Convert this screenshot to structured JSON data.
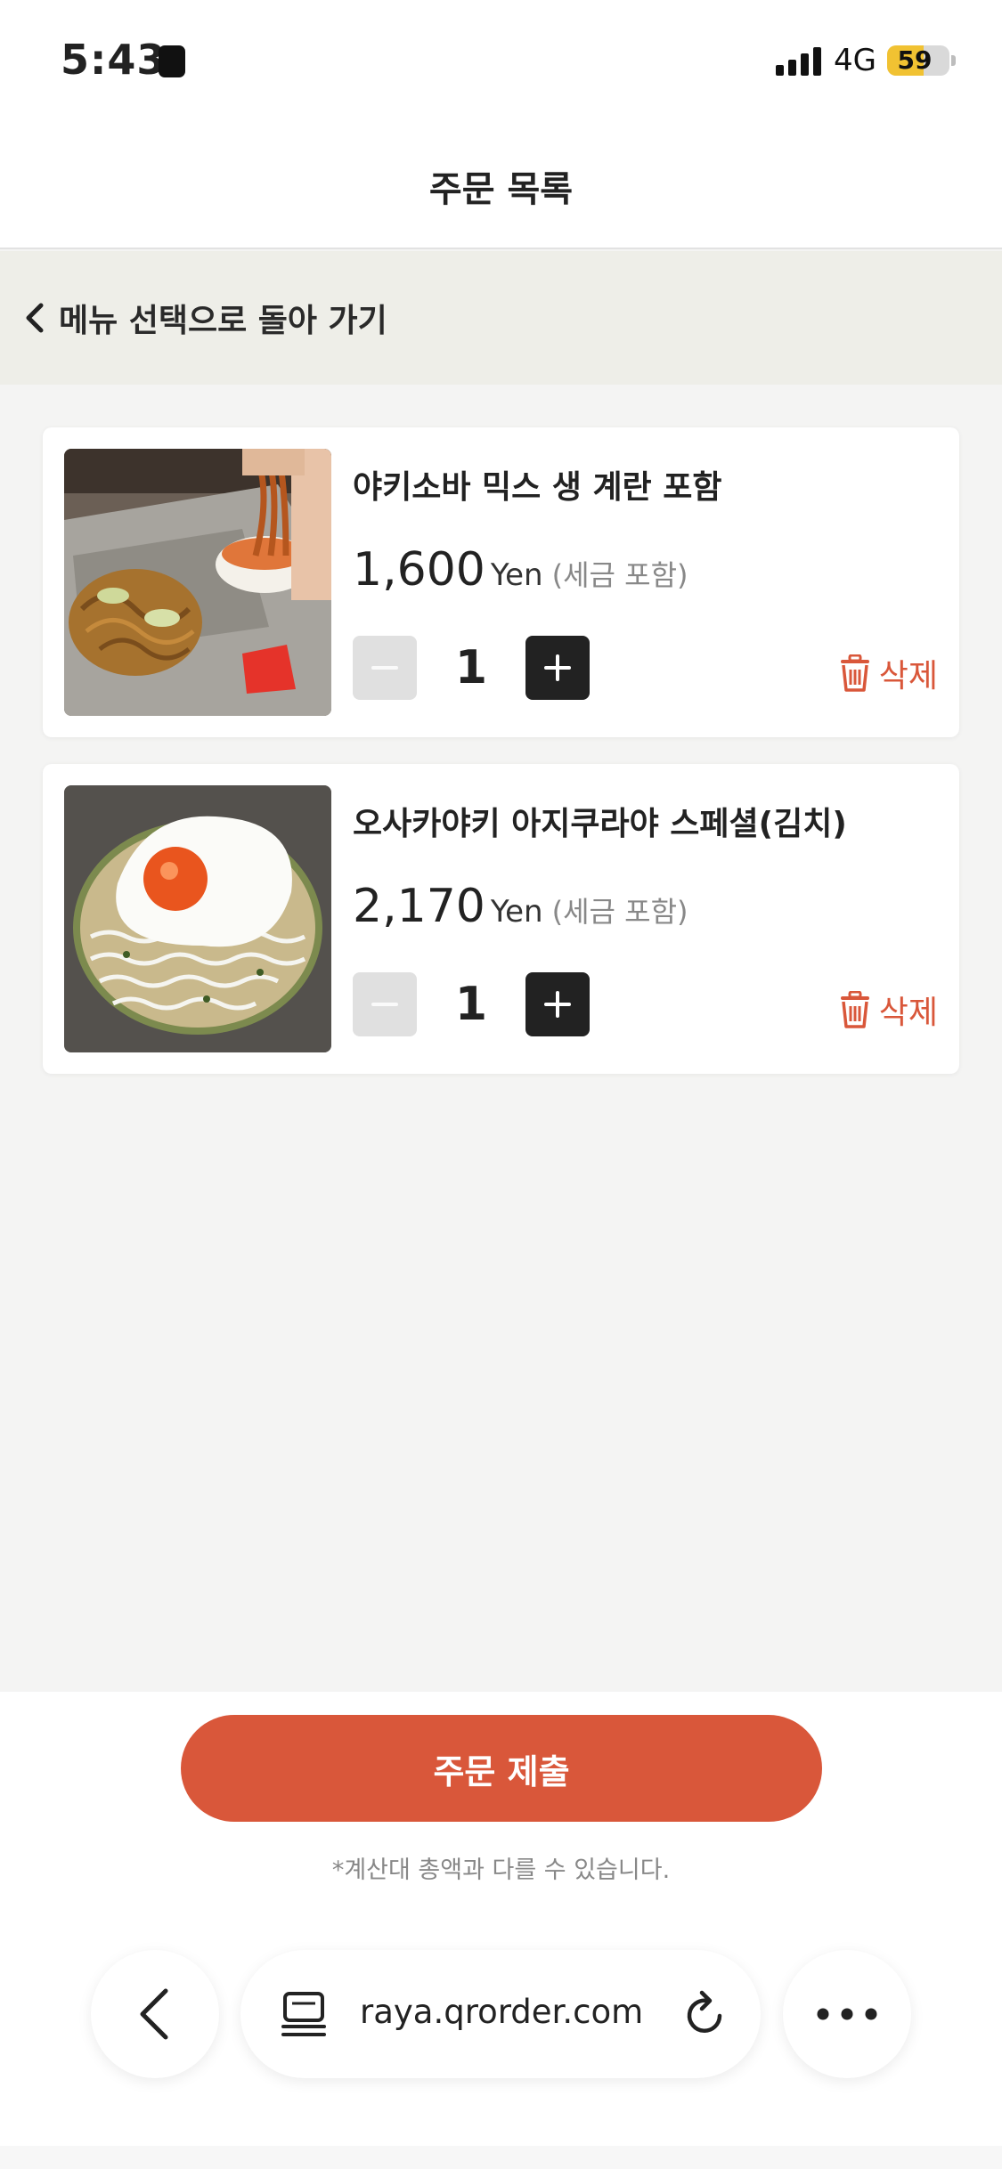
{
  "status_bar": {
    "time": "5:43",
    "network": "4G",
    "battery": "59",
    "battery_level": 0.59
  },
  "header": {
    "title": "주문 목록"
  },
  "back_link": {
    "label": "메뉴 선택으로 돌아 가기"
  },
  "cart": {
    "items": [
      {
        "name": "야키소바 믹스 생 계란 포함",
        "price": "1,600",
        "currency": "Yen",
        "tax_note": "(세금 포함)",
        "quantity": "1",
        "delete_label": "삭제",
        "image": "yakisoba-photo"
      },
      {
        "name": "오사카야키 아지쿠라야 스페셜(김치)",
        "price": "2,170",
        "currency": "Yen",
        "tax_note": "(세금 포함)",
        "quantity": "1",
        "delete_label": "삭제",
        "image": "okonomiyaki-photo"
      }
    ]
  },
  "submit": {
    "label": "주문 제출",
    "note": "*계산대 총액과 다를 수 있습니다."
  },
  "browser": {
    "url": "raya.qrorder.com"
  },
  "colors": {
    "accent": "#d9573a",
    "dark_button": "#222222",
    "back_bar_bg": "#eeeee8",
    "page_bg": "#f4f4f3"
  },
  "icons": [
    "person-badge-icon",
    "signal-icon",
    "battery-icon",
    "chevron-left-icon",
    "minus-icon",
    "plus-icon",
    "trash-icon",
    "reader-icon",
    "reload-icon",
    "more-icon"
  ]
}
